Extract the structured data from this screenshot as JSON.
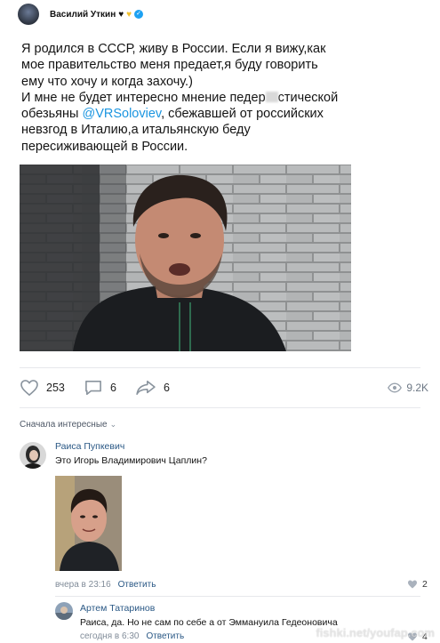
{
  "tweet": {
    "author": "Василий Уткин",
    "lines": [
      "Я родился в СССР, живу в России. Если я вижу,как",
      "мое правительство меня предает,я буду говорить",
      "ему что хочу и когда захочу.)",
      "И мне не будет интересно мнение педер",
      "стической",
      "обезьяны ",
      "@VRSoloviev",
      ", сбежавшей от российских",
      "невзгод в Италию,а итальянскую беду",
      "пересиживающей в России."
    ]
  },
  "post_actions": {
    "likes": "253",
    "comments": "6",
    "shares": "6",
    "views": "9.2K"
  },
  "comments_sort": "Сначала интересные",
  "comments": [
    {
      "author": "Раиса Пупкевич",
      "text": "Это  Игорь Владимирович Цаплин?",
      "time": "вчера в 23:16",
      "reply_label": "Ответить",
      "likes": "2"
    },
    {
      "author": "Артем Татаринов",
      "text": "Раиса, да. Но не сам по себе а от Эммануила Гедеоновича",
      "time": "сегодня в 6:30",
      "reply_label": "Ответить",
      "likes": "4"
    }
  ],
  "watermark": "fishki.net/youfap.com"
}
